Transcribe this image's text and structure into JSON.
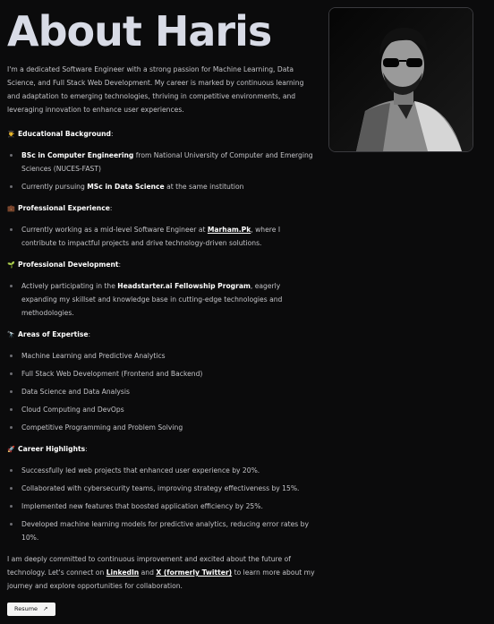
{
  "title": "About Haris",
  "intro": "I'm a dedicated Software Engineer with a strong passion for Machine Learning, Data Science, and Full Stack Web Development. My career is marked by continuous learning and adaptation to emerging technologies, thriving in competitive environments, and leveraging innovation to enhance user experiences.",
  "sections": {
    "education": {
      "emoji": "👨‍🎓",
      "heading": "Educational Background",
      "item1_bold": "BSc in Computer Engineering",
      "item1_rest": " from National University of Computer and Emerging Sciences (NUCES-FAST)",
      "item2_pre": "Currently pursuing ",
      "item2_bold": "MSc in Data Science",
      "item2_post": " at the same institution"
    },
    "experience": {
      "emoji": "💼",
      "heading": "Professional Experience",
      "item1_pre": "Currently working as a mid-level Software Engineer at ",
      "item1_link": "Marham.Pk",
      "item1_post": ", where I contribute to impactful projects and drive technology-driven solutions."
    },
    "development": {
      "emoji": "🌱",
      "heading": "Professional Development",
      "item1_pre": "Actively participating in the ",
      "item1_bold": "Headstarter.ai Fellowship Program",
      "item1_post": ", eagerly expanding my skillset and knowledge base in cutting-edge technologies and methodologies."
    },
    "expertise": {
      "emoji": "🔭",
      "heading": "Areas of Expertise",
      "items": [
        "Machine Learning and Predictive Analytics",
        "Full Stack Web Development (Frontend and Backend)",
        "Data Science and Data Analysis",
        "Cloud Computing and DevOps",
        "Competitive Programming and Problem Solving"
      ]
    },
    "highlights": {
      "emoji": "🚀",
      "heading": "Career Highlights",
      "items": [
        "Successfully led web projects that enhanced user experience by 20%.",
        "Collaborated with cybersecurity teams, improving strategy effectiveness by 15%.",
        "Implemented new features that boosted application efficiency by 25%.",
        "Developed machine learning models for predictive analytics, reducing error rates by 10%."
      ]
    }
  },
  "outro": {
    "pre": "I am deeply committed to continuous improvement and excited about the future of technology. Let's connect on ",
    "linkedin": "LinkedIn",
    "and": " and ",
    "twitter": "X (formerly Twitter)",
    "post": " to learn more about my journey and explore opportunities for collaboration."
  },
  "resume_button": {
    "label": "Resume",
    "icon": "arrow-up-right-icon"
  },
  "colon": ":"
}
